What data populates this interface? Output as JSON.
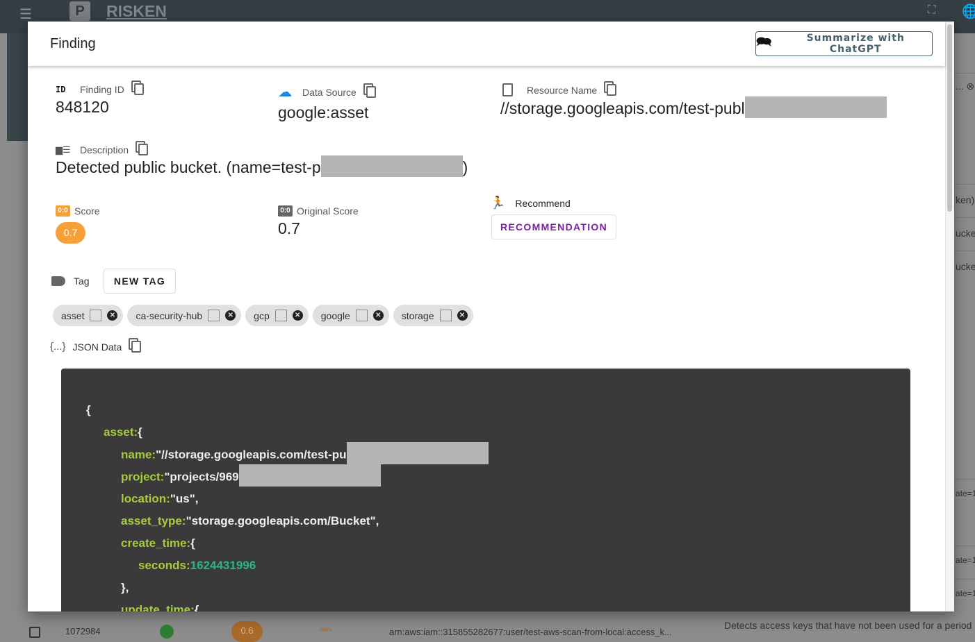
{
  "app": {
    "brand": "RISKEN",
    "logo_letter": "P"
  },
  "background": {
    "right_fragments": [
      "...",
      "ken)",
      "ucket",
      "ucket",
      "ate=1",
      "ate=1",
      "ate=1"
    ],
    "bottom_row": {
      "id": "1072984",
      "score": "0.6",
      "source": "aws",
      "resource": "arn:aws:iam::315855282677:user/test-aws-scan-from-local:access_k...",
      "description": "Detects access keys that have not been used for a period"
    }
  },
  "modal": {
    "title": "Finding",
    "summarize_label": "Summarize with ChatGPT",
    "finding_id": {
      "label": "Finding ID",
      "icon_text": "ID",
      "value": "848120"
    },
    "data_source": {
      "label": "Data Source",
      "value": "google:asset"
    },
    "resource_name": {
      "label": "Resource Name",
      "value": "//storage.googleapis.com/test-publ"
    },
    "description": {
      "label": "Description",
      "value": "Detected public bucket. (name=test-p",
      "value_end": ")"
    },
    "score": {
      "label": "Score",
      "value": "0.7",
      "color": "#f6a03a"
    },
    "original_score": {
      "label": "Original Score",
      "value": "0.7"
    },
    "recommend": {
      "label": "Recommend",
      "button": "RECOMMENDATION",
      "button_color": "#7b1fa2"
    },
    "tag": {
      "label": "Tag",
      "new_tag": "NEW TAG",
      "tags": [
        "asset",
        "ca-security-hub",
        "gcp",
        "google",
        "storage"
      ]
    },
    "json_data": {
      "label": "JSON Data",
      "icon_text": "{...}",
      "lines": [
        {
          "indent": 0,
          "key": "",
          "val": "{",
          "type": "punct"
        },
        {
          "indent": 1,
          "key": "asset:",
          "val": "{",
          "type": "punct"
        },
        {
          "indent": 2,
          "key": "name:",
          "val": "\"//storage.googleapis.com/test-pu",
          "type": "str",
          "redacted": true
        },
        {
          "indent": 2,
          "key": "project:",
          "val": "\"projects/969",
          "type": "str",
          "redacted": true
        },
        {
          "indent": 2,
          "key": "location:",
          "val": "\"us\",",
          "type": "str"
        },
        {
          "indent": 2,
          "key": "asset_type:",
          "val": "\"storage.googleapis.com/Bucket\",",
          "type": "str"
        },
        {
          "indent": 2,
          "key": "create_time:",
          "val": "{",
          "type": "punct"
        },
        {
          "indent": 3,
          "key": "seconds:",
          "val": "1624431996",
          "type": "num"
        },
        {
          "indent": 2,
          "key": "",
          "val": "},",
          "type": "punct"
        },
        {
          "indent": 2,
          "key": "update_time:",
          "val": "{",
          "type": "punct"
        }
      ]
    }
  }
}
